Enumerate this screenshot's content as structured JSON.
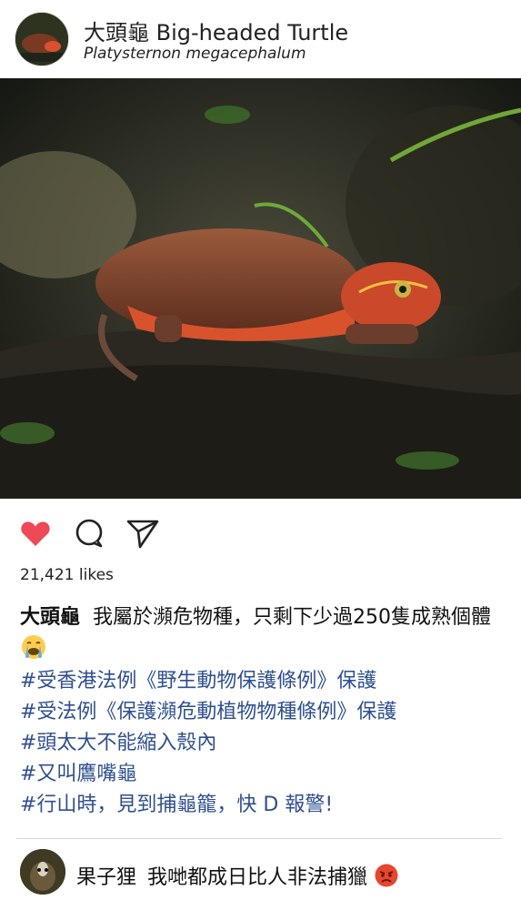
{
  "post": {
    "title": "大頭龜  Big-headed Turtle",
    "subtitle": "Platysternon megacephalum",
    "likes": "21,421 likes",
    "caption_user": "大頭龜",
    "caption_text": "我屬於瀕危物種，只剩下少過250隻成熟個體",
    "hashtags": [
      "#受香港法例《野生動物保護條例》保護",
      "#受法例《保護瀕危動植物物種條例》保護",
      "#頭太大不能縮入殼內",
      "#又叫鷹嘴龜",
      "#行山時，見到捕龜籠，快 D 報警!"
    ]
  },
  "comment": {
    "user": "果子狸",
    "text": "我哋都成日比人非法捕獵"
  },
  "icons": {
    "like": "heart-icon",
    "comment": "comment-bubble-icon",
    "share": "send-icon",
    "caption_emoji": "crying-face-emoji",
    "comment_emoji": "angry-face-emoji"
  },
  "colors": {
    "heart": "#ed4956",
    "hashtag": "#2f4f8f",
    "divider": "#d6d6d6"
  }
}
